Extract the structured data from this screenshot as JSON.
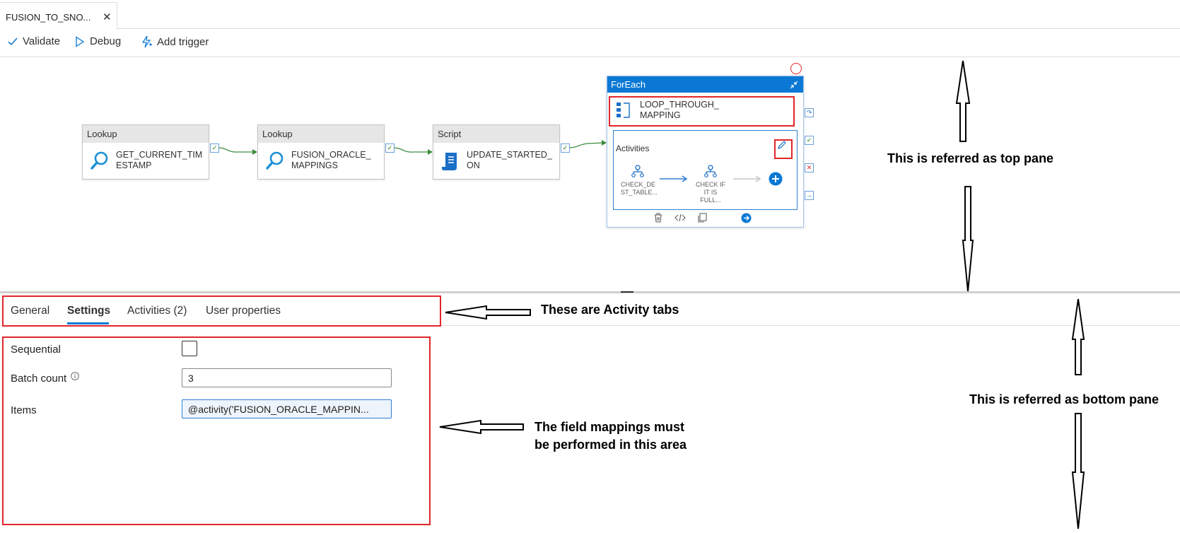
{
  "document_tab": {
    "label": "FUSION_TO_SNO...",
    "close": "✕"
  },
  "toolbar": {
    "validate": "Validate",
    "debug": "Debug",
    "add_trigger": "Add trigger"
  },
  "pipeline": {
    "nodes": [
      {
        "type": "Lookup",
        "name_line1": "GET_CURRENT_TIM",
        "name_line2": "ESTAMP",
        "icon": "search-icon"
      },
      {
        "type": "Lookup",
        "name_line1": "FUSION_ORACLE_",
        "name_line2": "MAPPINGS",
        "icon": "search-icon"
      },
      {
        "type": "Script",
        "name_line1": "UPDATE_STARTED_",
        "name_line2": "ON",
        "icon": "script-icon"
      }
    ],
    "foreach": {
      "type": "ForEach",
      "name_line1": "LOOP_THROUGH_",
      "name_line2": "MAPPING",
      "activities_label": "Activities",
      "inner": [
        {
          "line1": "CHECK_DE",
          "line2": "ST_TABLE..."
        },
        {
          "line1": "CHECK IF",
          "line2": "IT IS FULL..."
        }
      ]
    }
  },
  "activity_tabs": {
    "general": "General",
    "settings": "Settings",
    "activities": "Activities (2)",
    "user_properties": "User properties",
    "selected": "Settings"
  },
  "settings": {
    "sequential_label": "Sequential",
    "sequential_checked": false,
    "batch_count_label": "Batch count",
    "batch_count_value": "3",
    "items_label": "Items",
    "items_value": "@activity('FUSION_ORACLE_MAPPIN..."
  },
  "annotations": {
    "top_pane": "This is referred as top pane",
    "activity_tabs": "These are Activity tabs",
    "bottom_pane": "This is referred as bottom pane",
    "field_mappings_line1": "The field mappings must",
    "field_mappings_line2": "be performed in this area"
  },
  "colors": {
    "accent": "#0a78d4",
    "highlight": "#e0262b",
    "success": "#107c10"
  }
}
